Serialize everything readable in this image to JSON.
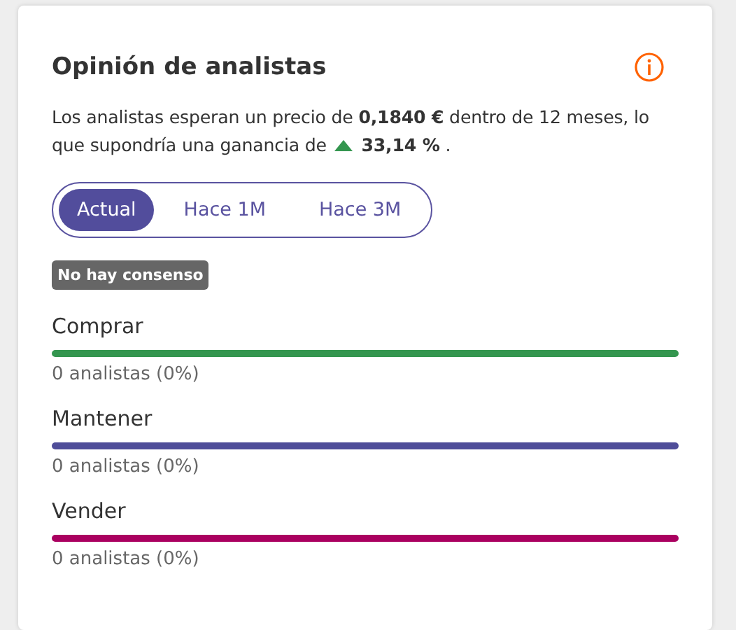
{
  "card": {
    "title": "Opinión de analistas",
    "summary_before": "Los analistas esperan un precio de **0,1840 €** dentro de 12 meses, lo que supondría una ganancia de",
    "change_positive": true,
    "summary_after": "**33,14 %** .",
    "tabs": [
      {
        "label": "Actual",
        "selected": true
      },
      {
        "label": "Hace 1M",
        "selected": false
      },
      {
        "label": "Hace 3M",
        "selected": false
      }
    ],
    "badge": "No hay consenso",
    "ratings": [
      {
        "label": "Comprar",
        "color": "#34964f",
        "count": "0 analistas (0%)"
      },
      {
        "label": "Mantener",
        "color": "#4f4d99",
        "count": "0 analistas (0%)"
      },
      {
        "label": "Vender",
        "color": "#aa0060",
        "count": "0 analistas (0%)"
      }
    ]
  }
}
